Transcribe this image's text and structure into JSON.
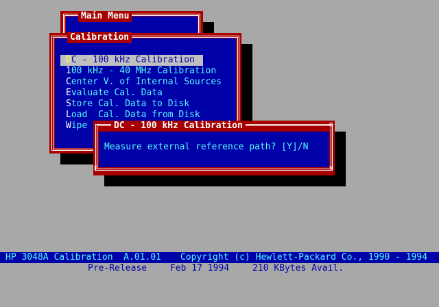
{
  "main_menu": {
    "title": "Main Menu"
  },
  "calibration_menu": {
    "title": "Calibration",
    "items": [
      {
        "hot": "D",
        "rest": "C - 100 kHz Calibration"
      },
      {
        "hot": "1",
        "rest": "00 kHz - 40 MHz Calibration"
      },
      {
        "hot": "C",
        "rest": "enter V. of Internal Sources"
      },
      {
        "hot": "E",
        "rest": "valuate Cal. Data"
      },
      {
        "hot": "S",
        "rest": "tore Cal. Data to Disk"
      },
      {
        "hot": "L",
        "rest": "oad  Cal. Data from Disk"
      },
      {
        "hot": "W",
        "rest": "ipe"
      }
    ],
    "selected_index": 0
  },
  "dialog": {
    "title": "DC - 100 kHz Calibration",
    "message": "Measure external reference path? [Y]/N"
  },
  "status": {
    "line1_left": "HP 3048A Calibration  A.01.01",
    "line1_right": "Copyright (c) Hewlett-Packard Co., 1990 - 1994",
    "prerelease": "Pre-Release",
    "date": "Feb 17 1994",
    "memory": "210 KBytes Avail."
  },
  "colors": {
    "desktop": "#a8a8a8",
    "window_bg": "#0000a8",
    "frame": "#a80000",
    "text": "#54fcfc",
    "highlight": "#c0c0c0"
  }
}
